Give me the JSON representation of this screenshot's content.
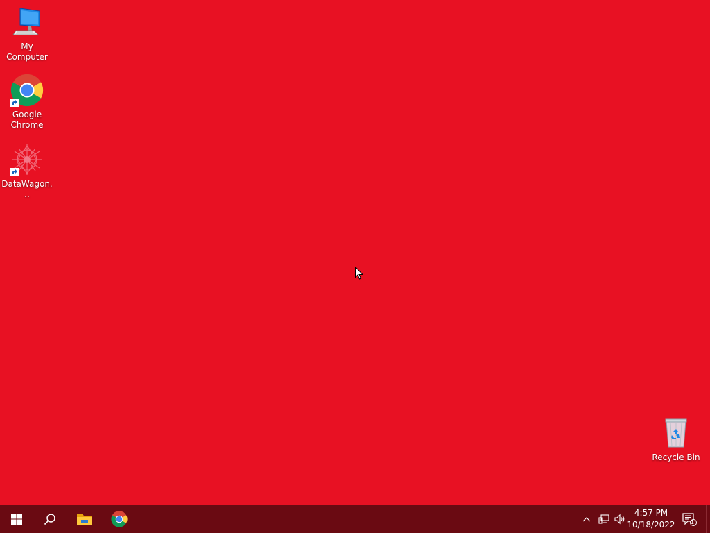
{
  "desktop": {
    "background_color": "#e81123",
    "icons": [
      {
        "label": "My Computer",
        "icon": "computer-monitor-icon"
      },
      {
        "label": "Google Chrome",
        "icon": "chrome-icon",
        "shortcut": true
      },
      {
        "label": "DataWagon...",
        "icon": "datawagon-icon",
        "shortcut": true
      },
      {
        "label": "Recycle Bin",
        "icon": "recycle-bin-icon"
      }
    ]
  },
  "taskbar": {
    "background_color": "#6a0a12",
    "pinned": [
      {
        "name": "Start",
        "icon": "windows-logo-icon"
      },
      {
        "name": "Search",
        "icon": "search-icon"
      },
      {
        "name": "File Explorer",
        "icon": "folder-icon"
      },
      {
        "name": "Google Chrome",
        "icon": "chrome-icon"
      }
    ],
    "tray": {
      "time": "4:57 PM",
      "date": "10/18/2022",
      "notification_count": "1",
      "icons": [
        "chevron-up-icon",
        "network-icon",
        "volume-icon",
        "action-center-icon"
      ]
    }
  }
}
